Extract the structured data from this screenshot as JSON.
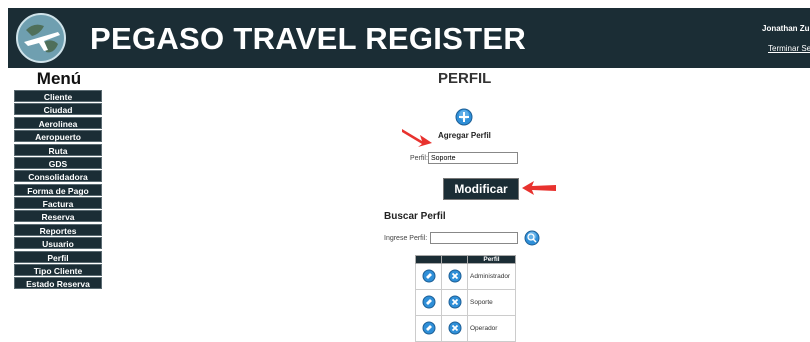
{
  "header": {
    "title": "PEGASO TRAVEL REGISTER",
    "user_name": "Jonathan Zuri",
    "logout_label": "Terminar Sesi"
  },
  "menu": {
    "title": "Menú",
    "items": [
      {
        "label": "Cliente"
      },
      {
        "label": "Ciudad"
      },
      {
        "label": "Aerolinea"
      },
      {
        "label": "Aeropuerto"
      },
      {
        "label": "Ruta"
      },
      {
        "label": "GDS"
      },
      {
        "label": "Consolidadora"
      },
      {
        "label": "Forma de Pago"
      },
      {
        "label": "Factura"
      },
      {
        "label": "Reserva"
      },
      {
        "label": "Reportes"
      },
      {
        "label": "Usuario"
      },
      {
        "label": "Perfil"
      },
      {
        "label": "Tipo Cliente"
      },
      {
        "label": "Estado Reserva"
      }
    ]
  },
  "main": {
    "title": "PERFIL",
    "add_label": "Agregar Perfil",
    "perfil_label": "Perfil:",
    "perfil_value": "Soporte",
    "modify_label": "Modificar",
    "search_title": "Buscar Perfil",
    "search_label": "Ingrese Perfil:",
    "search_value": "",
    "table": {
      "header": "Perfil",
      "rows": [
        {
          "name": "Administrador"
        },
        {
          "name": "Soporte"
        },
        {
          "name": "Operador"
        }
      ]
    }
  },
  "colors": {
    "header_bg": "#1b2d35",
    "arrow": "#e8322e",
    "icon_blue": "#2f8fd8"
  }
}
